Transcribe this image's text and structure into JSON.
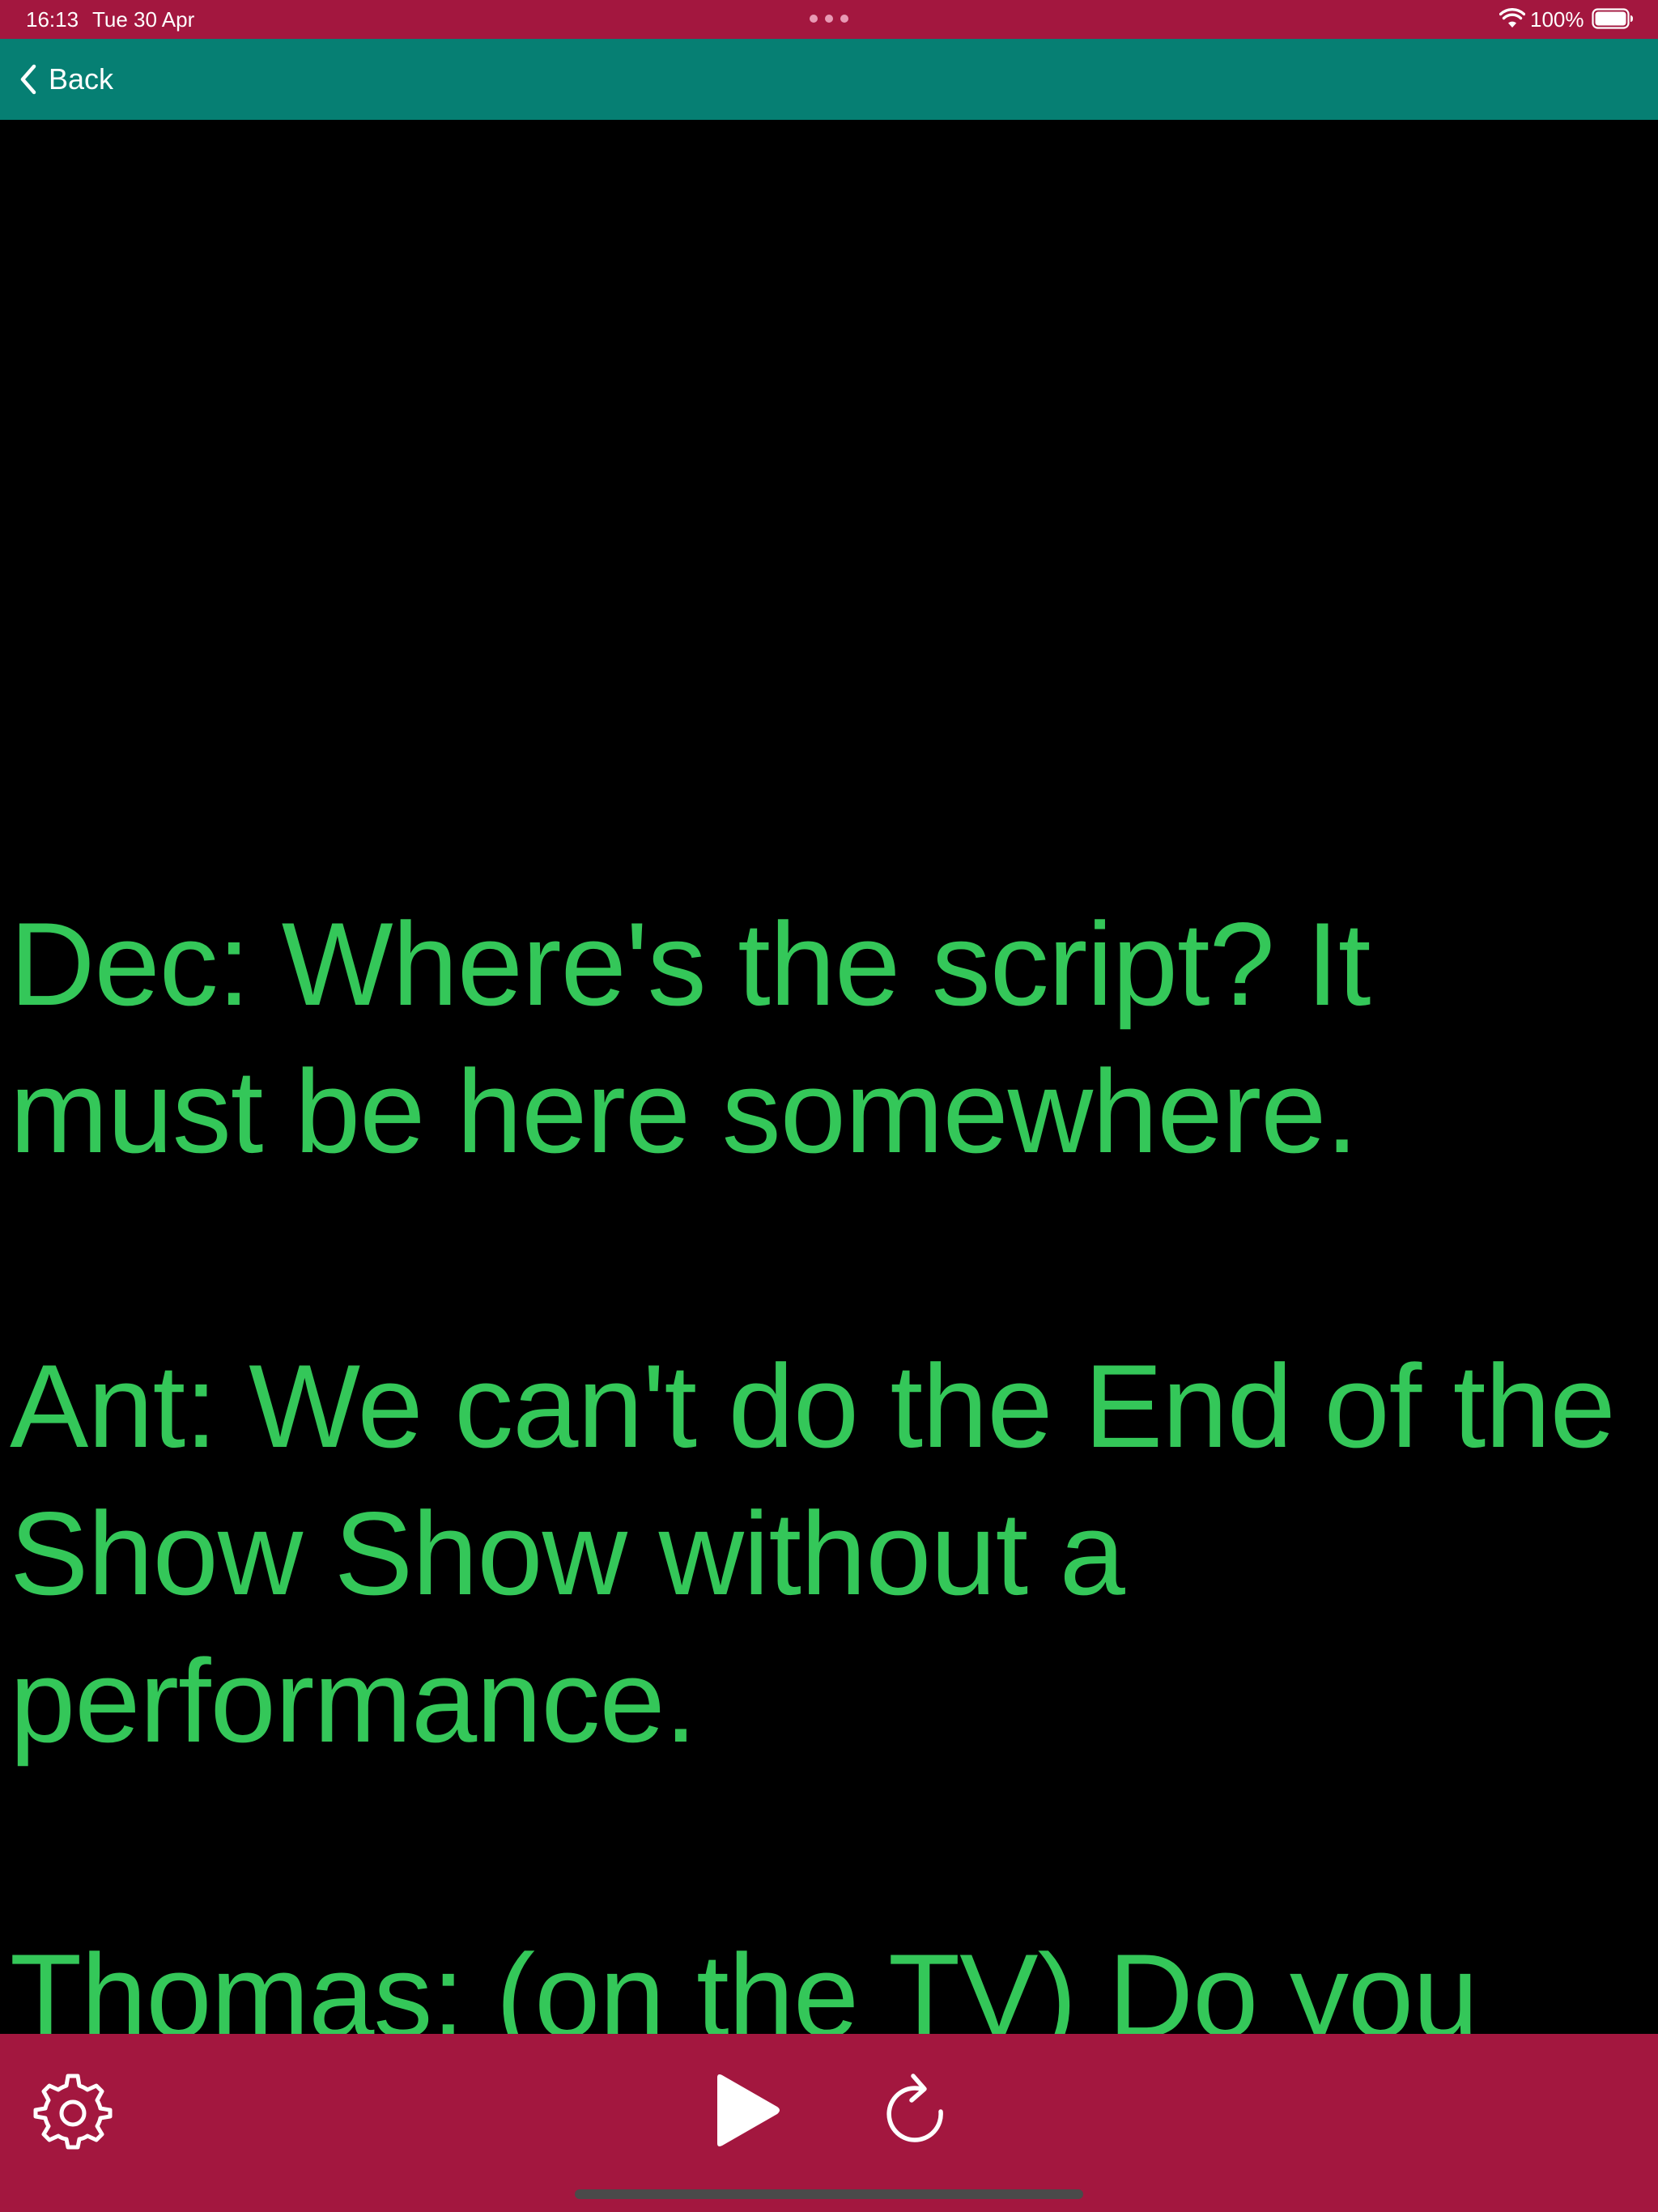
{
  "status_bar": {
    "time": "16:13",
    "date": "Tue 30 Apr",
    "battery_percent": "100%",
    "battery_level": 1.0,
    "icons": [
      "multitask-dots",
      "wifi-icon",
      "battery-icon"
    ]
  },
  "nav_bar": {
    "back_label": "Back",
    "back_icon": "chevron-left-icon"
  },
  "script": {
    "lines": [
      "Dec: Where's the script? It must be here somewhere.",
      "Ant: We can't do the End of the Show Show without a performance.",
      "Thomas: (on the TV) Do you"
    ],
    "text_color": "#34C759"
  },
  "toolbar": {
    "icons": [
      "gear-icon",
      "play-icon",
      "reload-icon"
    ]
  },
  "colors": {
    "status_bar": "#A3173F",
    "nav_bar": "#067F73",
    "background": "#000000",
    "toolbar": "#A3173F"
  }
}
